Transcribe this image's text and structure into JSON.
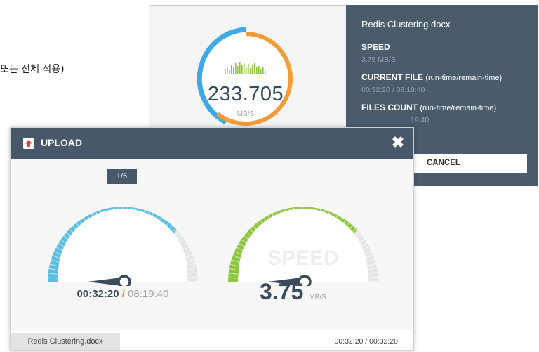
{
  "side_note": "또는 전체 적용)",
  "background_panel": {
    "speed_value": "233.705",
    "speed_unit": "MB/S",
    "info": {
      "file_name": "Redis Clustering.docx",
      "speed_label": "SPEED",
      "speed_value": "3.75 MB/S",
      "current_file_label": "CURRENT FILE",
      "current_file_sub": "(run-time/remain-time)",
      "current_file_value": "00:32:20 / 08:19:40",
      "files_count_label": "FILES COUNT",
      "files_count_sub": "(run-time/remain-time)",
      "files_count_value": "19:40"
    },
    "cancel_label": "CANCEL"
  },
  "dialog": {
    "title": "UPLOAD",
    "close_label": "✖",
    "file_progress_badge": "1/5",
    "time_progress_fraction": 0.065,
    "run_time": "00:32:20",
    "separator": "/",
    "remain_time": "08:19:40",
    "speed_watermark": "SPEED",
    "speed_value": "3.75",
    "speed_unit": "MB/S",
    "footer_file": "Redis Clustering.docx",
    "footer_time": "00:32:20 / 00:32:20"
  },
  "colors": {
    "header": "#46586a",
    "blue_gauge": "#5bbde0",
    "green_gauge": "#8cc63f",
    "orange_ring": "#f29c38"
  }
}
